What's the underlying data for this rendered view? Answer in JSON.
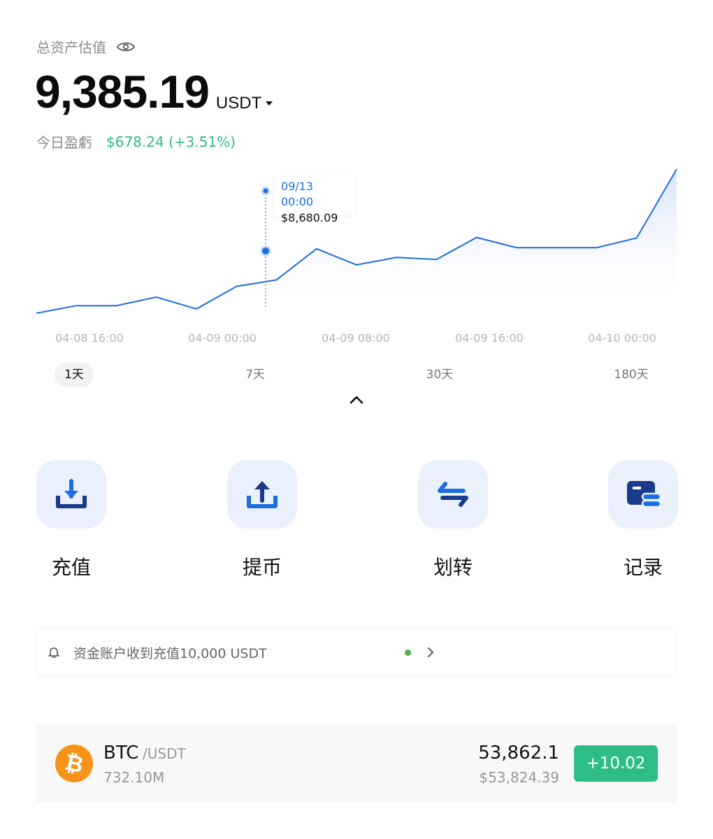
{
  "header": {
    "label": "总资产估值"
  },
  "balance": {
    "value": "9,385.19",
    "unit": "USDT"
  },
  "pnl": {
    "label": "今日盈虧",
    "value": "$678.24 (+3.51%)"
  },
  "chart_data": {
    "type": "area",
    "x_ticks": [
      "04-08 16:00",
      "04-09 00:00",
      "04-09 08:00",
      "04-09 16:00",
      "04-10 00:00"
    ],
    "y": [
      8560,
      8574,
      8574,
      8590,
      8568,
      8610,
      8622,
      8680,
      8650,
      8664,
      8660,
      8701,
      8682,
      8682,
      8682,
      8700,
      8828
    ],
    "tooltip": {
      "date": "09/13 00:00",
      "value": "$8,680.09"
    },
    "colors": {
      "line": "#1c6fe0",
      "fill": "#dde6fb"
    }
  },
  "ranges": [
    {
      "label": "1天",
      "active": true
    },
    {
      "label": "7天",
      "active": false
    },
    {
      "label": "30天",
      "active": false
    },
    {
      "label": "180天",
      "active": false
    }
  ],
  "actions": [
    {
      "label": "充值",
      "icon": "deposit-icon"
    },
    {
      "label": "提币",
      "icon": "withdraw-icon"
    },
    {
      "label": "划转",
      "icon": "transfer-icon"
    },
    {
      "label": "记录",
      "icon": "records-icon"
    }
  ],
  "notice": {
    "text": "资金账户收到充值10,000 USDT"
  },
  "coin": {
    "symbol": "BTC",
    "quote": "/USDT",
    "volume": "732.10M",
    "price": "53,862.1",
    "fiat_price": "$53,824.39",
    "change": "+10.02"
  },
  "colors": {
    "accent": "#1c6fe0",
    "up": "#2ebd85",
    "icon_bg": "#eaf1fd"
  }
}
